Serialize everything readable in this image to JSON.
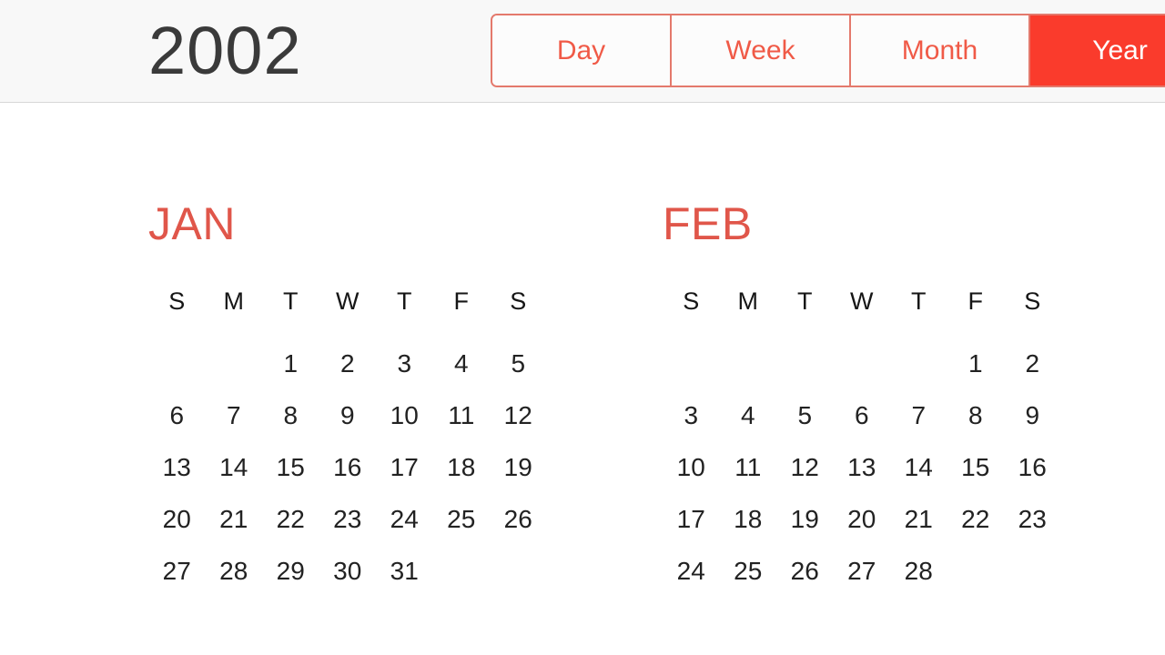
{
  "header": {
    "year_title": "2002",
    "view_switcher": {
      "options": [
        {
          "label": "Day",
          "active": false
        },
        {
          "label": "Week",
          "active": false
        },
        {
          "label": "Month",
          "active": false
        },
        {
          "label": "Year",
          "active": true
        }
      ],
      "selected": "Year"
    }
  },
  "colors": {
    "accent_red": "#fa3b2c",
    "month_label_red": "#e0564a",
    "segment_text_red": "#f05a47",
    "segment_border_red": "#e4796c",
    "header_background": "#f8f8f8",
    "header_border": "#d7d7d7",
    "day_text": "#222222",
    "weekday_text": "#161616",
    "year_title_text": "#3a3a3a",
    "page_background": "#ffffff"
  },
  "calendar": {
    "year": "2002",
    "weekday_initials": [
      "S",
      "M",
      "T",
      "W",
      "T",
      "F",
      "S"
    ],
    "months": [
      {
        "name": "JAN",
        "leading_blanks": 2,
        "days": [
          "1",
          "2",
          "3",
          "4",
          "5",
          "6",
          "7",
          "8",
          "9",
          "10",
          "11",
          "12",
          "13",
          "14",
          "15",
          "16",
          "17",
          "18",
          "19",
          "20",
          "21",
          "22",
          "23",
          "24",
          "25",
          "26",
          "27",
          "28",
          "29",
          "30",
          "31"
        ]
      },
      {
        "name": "FEB",
        "leading_blanks": 5,
        "days": [
          "1",
          "2",
          "3",
          "4",
          "5",
          "6",
          "7",
          "8",
          "9",
          "10",
          "11",
          "12",
          "13",
          "14",
          "15",
          "16",
          "17",
          "18",
          "19",
          "20",
          "21",
          "22",
          "23",
          "24",
          "25",
          "26",
          "27",
          "28"
        ]
      }
    ]
  }
}
